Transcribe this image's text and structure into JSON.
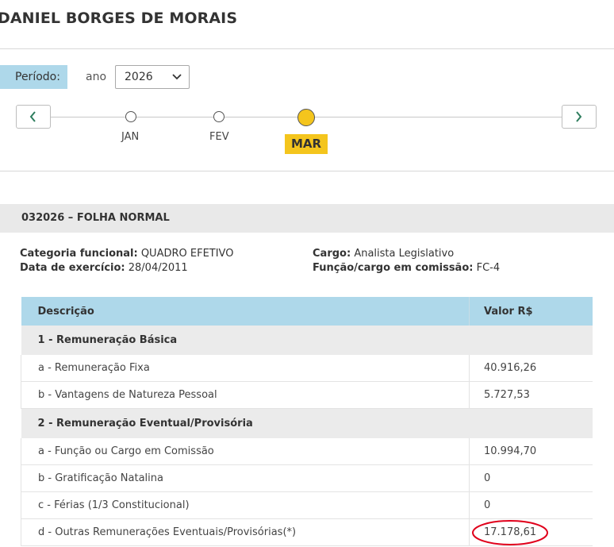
{
  "header": {
    "title": "DANIEL BORGES DE MORAIS"
  },
  "period": {
    "label": "Período:",
    "year_label": "ano",
    "year_value": "2026",
    "prev_icon": "chevron-left-icon",
    "next_icon": "chevron-right-icon",
    "months": [
      "JAN",
      "FEV"
    ],
    "active_month": "MAR"
  },
  "sheet": {
    "title": "032026 – FOLHA NORMAL"
  },
  "info": {
    "categoria_label": "Categoria funcional:",
    "categoria_value": "QUADRO EFETIVO",
    "data_label": "Data de exercício:",
    "data_value": "28/04/2011",
    "cargo_label": "Cargo:",
    "cargo_value": "Analista Legislativo",
    "funcao_label": "Função/cargo em comissão:",
    "funcao_value": "FC-4"
  },
  "table": {
    "headers": [
      "Descrição",
      "Valor R$"
    ],
    "groups": [
      {
        "title": "1 - Remuneração Básica",
        "rows": [
          {
            "desc": "a - Remuneração Fixa",
            "value": "40.916,26"
          },
          {
            "desc": "b - Vantagens de Natureza Pessoal",
            "value": "5.727,53"
          }
        ]
      },
      {
        "title": "2 - Remuneração Eventual/Provisória",
        "rows": [
          {
            "desc": "a - Função ou Cargo em Comissão",
            "value": "10.994,70"
          },
          {
            "desc": "b - Gratificação Natalina",
            "value": "0"
          },
          {
            "desc": "c - Férias (1/3 Constitucional)",
            "value": "0"
          },
          {
            "desc": "d - Outras Remunerações Eventuais/Provisórias(*)",
            "value": "17.178,61"
          }
        ]
      }
    ]
  },
  "colors": {
    "accent_blue": "#aed8ea",
    "active_yellow": "#f4c51d",
    "highlight_circle": "#e0001b"
  }
}
